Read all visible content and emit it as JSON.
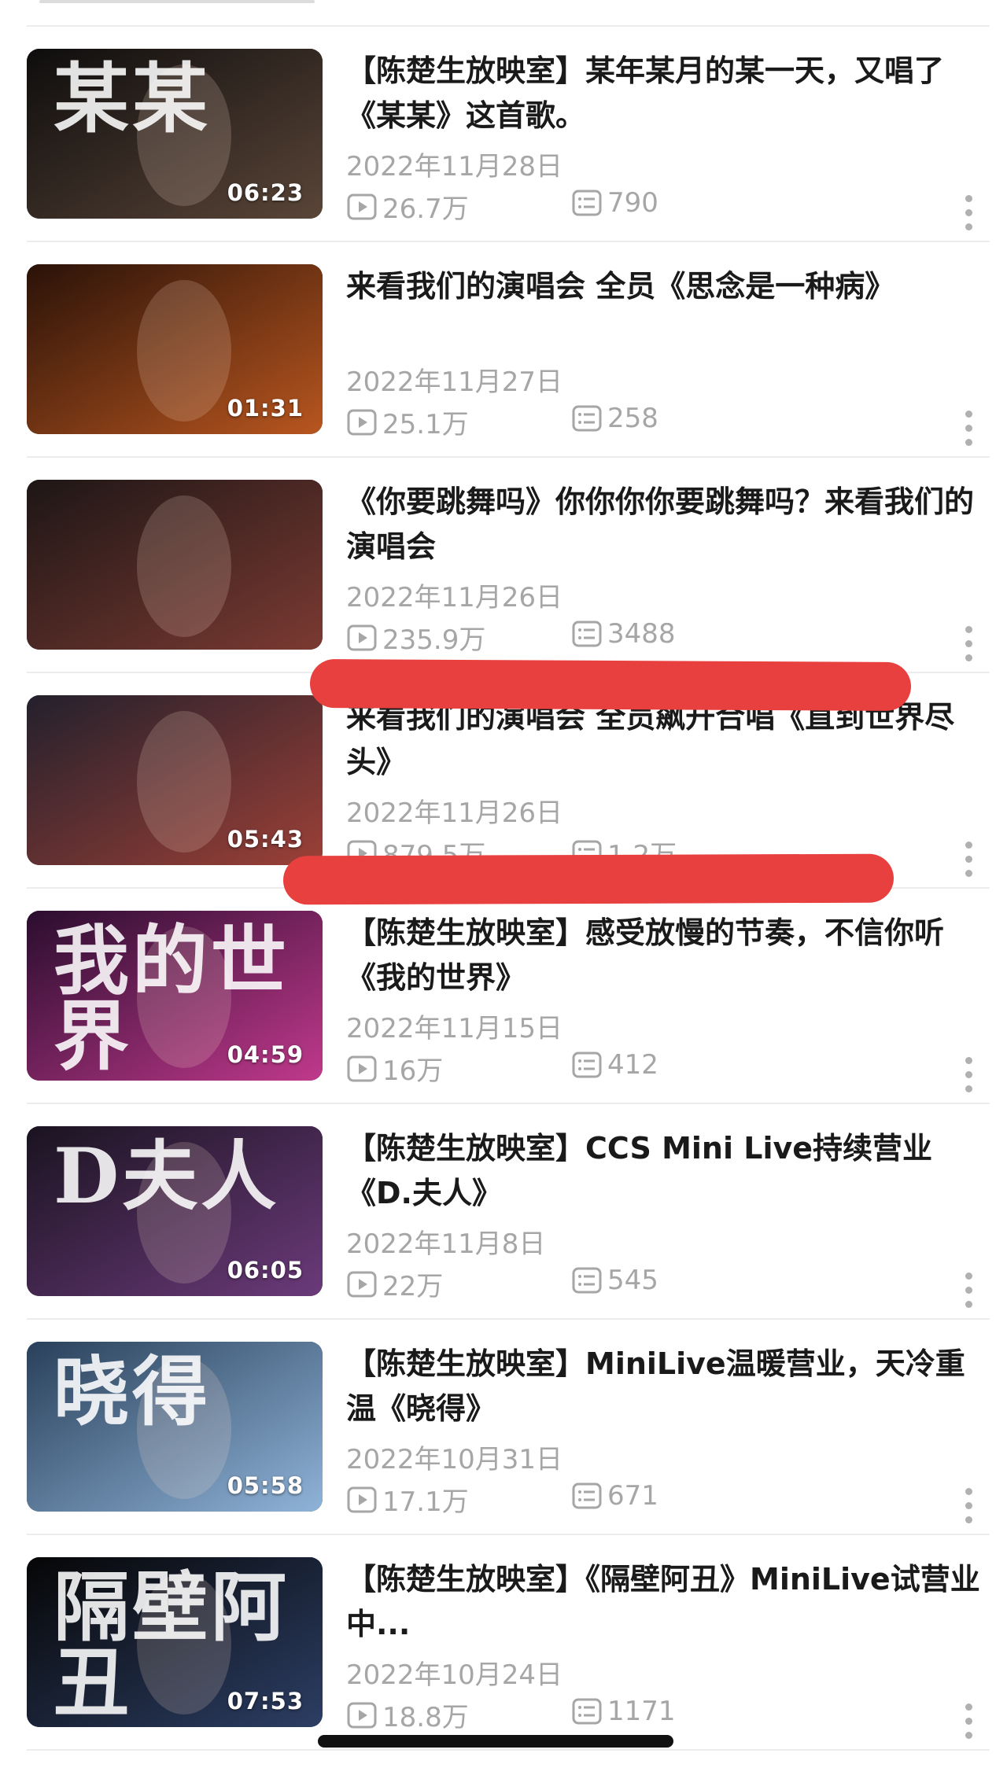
{
  "colors": {
    "meta_text": "#a6a6a6",
    "title_text": "#1a1a1a",
    "annotation": "#e8403f",
    "divider": "#ececec"
  },
  "videos": [
    {
      "title": "【陈楚生放映室】某年某月的某一天，又唱了《某某》这首歌。",
      "date": "2022年11月28日",
      "views": "26.7万",
      "comments": "790",
      "duration": "06:23",
      "thumb_text": "某某",
      "thumb_colors": [
        "#0e0d0d",
        "#5a4538"
      ]
    },
    {
      "title": "来看我们的演唱会 全员《思念是一种病》",
      "date": "2022年11月27日",
      "views": "25.1万",
      "comments": "258",
      "duration": "01:31",
      "thumb_text": "",
      "thumb_colors": [
        "#2a1208",
        "#b8561f"
      ]
    },
    {
      "title": "《你要跳舞吗》你你你你要跳舞吗？来看我们的演唱会",
      "date": "2022年11月26日",
      "views": "235.9万",
      "comments": "3488",
      "duration": "",
      "thumb_text": "",
      "thumb_colors": [
        "#1d1616",
        "#7b3a32"
      ]
    },
    {
      "title": "来看我们的演唱会 全员飙升合唱《直到世界尽头》",
      "date": "2022年11月26日",
      "views": "879.5万",
      "comments": "1.2万",
      "duration": "05:43",
      "thumb_text": "",
      "thumb_colors": [
        "#23202c",
        "#9c4037"
      ]
    },
    {
      "title": "【陈楚生放映室】感受放慢的节奏，不信你听《我的世界》",
      "date": "2022年11月15日",
      "views": "16万",
      "comments": "412",
      "duration": "04:59",
      "thumb_text": "我的世界",
      "thumb_colors": [
        "#2a0d2e",
        "#c0398c"
      ]
    },
    {
      "title": "【陈楚生放映室】CCS Mini Live持续营业《D.夫人》",
      "date": "2022年11月8日",
      "views": "22万",
      "comments": "545",
      "duration": "06:05",
      "thumb_text": "D夫人",
      "thumb_colors": [
        "#1a1320",
        "#6b3a7a"
      ]
    },
    {
      "title": "【陈楚生放映室】MiniLive温暖营业，天冷重温《晓得》",
      "date": "2022年10月31日",
      "views": "17.1万",
      "comments": "671",
      "duration": "05:58",
      "thumb_text": "晓得",
      "thumb_colors": [
        "#29405a",
        "#8fb3d8"
      ]
    },
    {
      "title": "【陈楚生放映室】《隔壁阿丑》MiniLive试营业中...",
      "date": "2022年10月24日",
      "views": "18.8万",
      "comments": "1171",
      "duration": "07:53",
      "thumb_text": "隔壁阿丑",
      "thumb_colors": [
        "#060606",
        "#2c3e64"
      ]
    }
  ]
}
